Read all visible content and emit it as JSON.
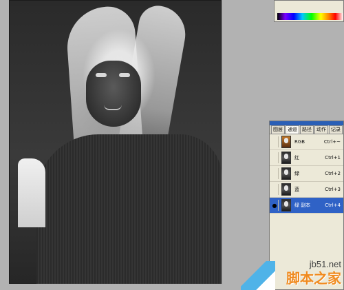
{
  "palette": {
    "tabs": [
      {
        "label": "图层"
      },
      {
        "label": "通道"
      },
      {
        "label": "路径"
      },
      {
        "label": "动作"
      },
      {
        "label": "记录"
      }
    ],
    "active_tab": "通道",
    "channels": [
      {
        "name": "RGB",
        "shortcut": "Ctrl+~",
        "visible": false,
        "selected": false
      },
      {
        "name": "红",
        "shortcut": "Ctrl+1",
        "visible": false,
        "selected": false
      },
      {
        "name": "绿",
        "shortcut": "Ctrl+2",
        "visible": false,
        "selected": false
      },
      {
        "name": "蓝",
        "shortcut": "Ctrl+3",
        "visible": false,
        "selected": false
      },
      {
        "name": "绿 副本",
        "shortcut": "Ctrl+4",
        "visible": true,
        "selected": true
      }
    ]
  },
  "watermark": {
    "url": "jb51.net",
    "site_name": "脚本之家"
  },
  "colors": {
    "selection": "#2f62c6",
    "palette_bg": "#ece9d8",
    "workspace": "#b2b2b2"
  }
}
